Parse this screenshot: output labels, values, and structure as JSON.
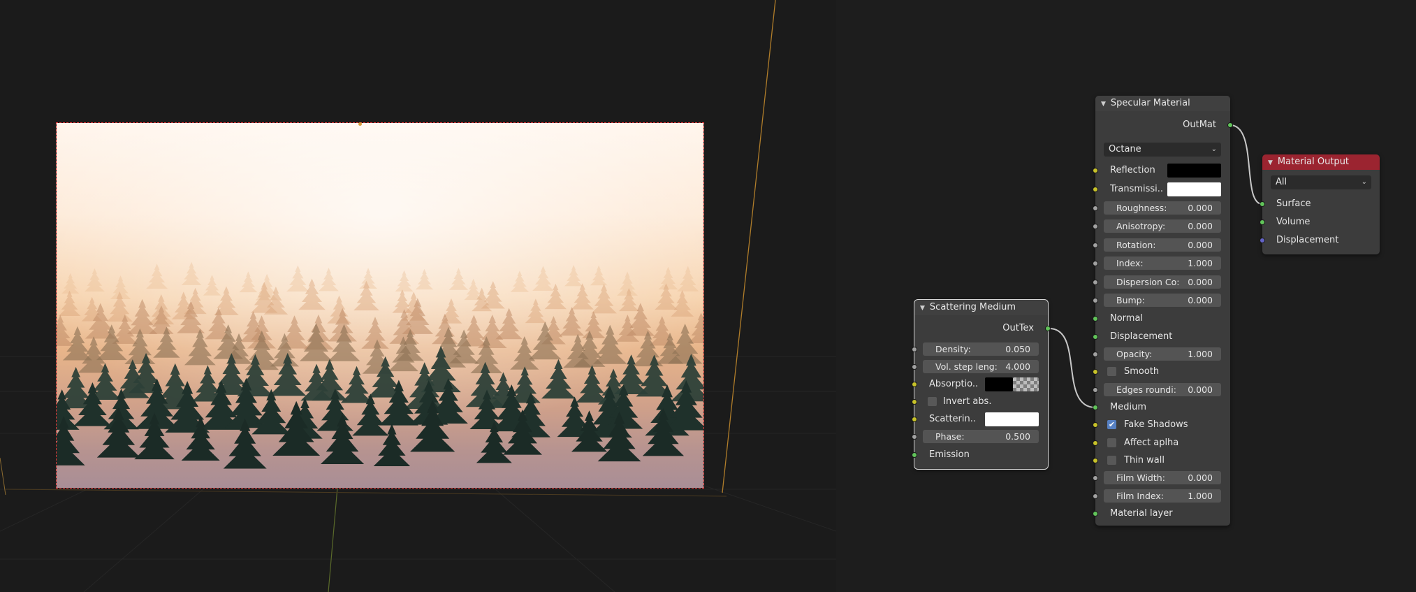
{
  "colors": {
    "socket_yellow": "#c7c229",
    "socket_green": "#61c45a",
    "socket_grey": "#a1a1a1",
    "socket_purple": "#6363c7",
    "output_header": "#9b2430",
    "checkbox_blue": "#5680c2"
  },
  "viewport": {
    "icons": {
      "camera_marker": "camera-center-dot"
    }
  },
  "scattering_medium": {
    "title": "Scattering Medium",
    "output": "OutTex",
    "density_label": "Density:",
    "density_value": "0.050",
    "vol_step_label": "Vol. step leng:",
    "vol_step_value": "4.000",
    "absorption_label": "Absorptio..",
    "invert_abs_label": "Invert abs.",
    "invert_abs_checked": false,
    "scattering_label": "Scatterin..",
    "phase_label": "Phase:",
    "phase_value": "0.500",
    "emission_label": "Emission"
  },
  "specular_material": {
    "title": "Specular Material",
    "output": "OutMat",
    "engine": "Octane",
    "reflection_label": "Reflection",
    "transmission_label": "Transmissi..",
    "roughness_label": "Roughness:",
    "roughness_value": "0.000",
    "anisotropy_label": "Anisotropy:",
    "anisotropy_value": "0.000",
    "rotation_label": "Rotation:",
    "rotation_value": "0.000",
    "index_label": "Index:",
    "index_value": "1.000",
    "dispersion_label": "Dispersion Co:",
    "dispersion_value": "0.000",
    "bump_label": "Bump:",
    "bump_value": "0.000",
    "normal_label": "Normal",
    "displacement_label": "Displacement",
    "opacity_label": "Opacity:",
    "opacity_value": "1.000",
    "smooth_label": "Smooth",
    "smooth_checked": false,
    "edges_label": "Edges roundi:",
    "edges_value": "0.000",
    "medium_label": "Medium",
    "fake_shadows_label": "Fake Shadows",
    "fake_shadows_checked": true,
    "affect_alpha_label": "Affect aplha",
    "affect_alpha_checked": false,
    "thin_wall_label": "Thin wall",
    "thin_wall_checked": false,
    "film_width_label": "Film Width:",
    "film_width_value": "0.000",
    "film_index_label": "Film Index:",
    "film_index_value": "1.000",
    "material_layer_label": "Material layer"
  },
  "material_output": {
    "title": "Material Output",
    "target": "All",
    "surface_label": "Surface",
    "volume_label": "Volume",
    "displacement_label": "Displacement"
  }
}
